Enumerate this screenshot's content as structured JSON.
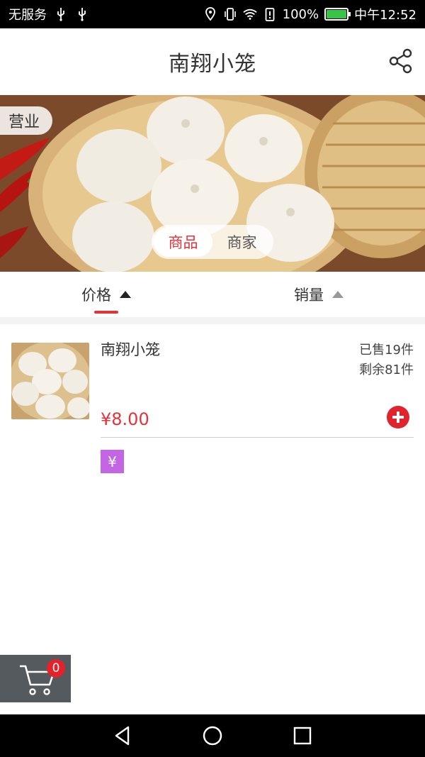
{
  "status_bar": {
    "carrier": "无服务",
    "battery_percent": "100%",
    "battery_level": 1.0,
    "time": "中午12:52",
    "icons": [
      "usb-icon",
      "usb-icon",
      "location-icon",
      "vibrate-icon",
      "wifi-icon",
      "battery-alert-icon",
      "battery-icon"
    ]
  },
  "header": {
    "title": "南翔小笼",
    "share_icon": "share-icon"
  },
  "banner": {
    "status_tag": "营业",
    "tabs": [
      {
        "label": "商品",
        "active": true
      },
      {
        "label": "商家",
        "active": false
      }
    ]
  },
  "sort": {
    "items": [
      {
        "label": "价格",
        "active": true
      },
      {
        "label": "销量",
        "active": false
      }
    ]
  },
  "products": [
    {
      "name": "南翔小笼",
      "sold": "已售19件",
      "remaining": "剩余81件",
      "price": "¥8.00",
      "badge": "¥"
    }
  ],
  "cart": {
    "count": "0"
  },
  "colors": {
    "accent": "#e5313a",
    "badge_purple": "#c266e4",
    "cart_bg": "#555a5e"
  }
}
